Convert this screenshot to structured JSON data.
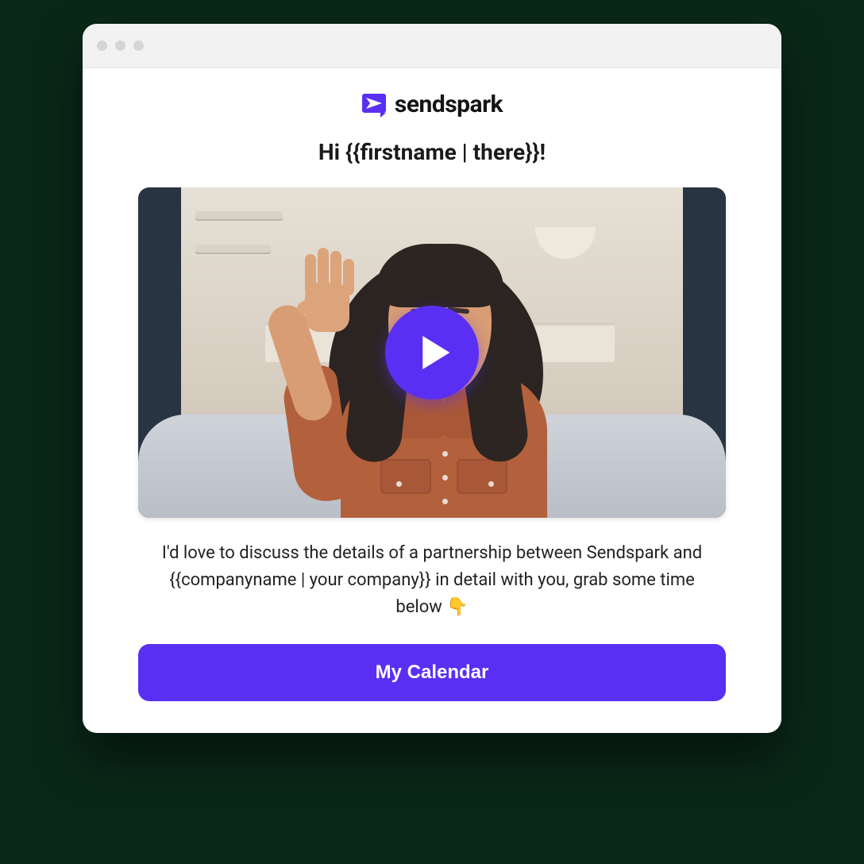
{
  "logo": {
    "text": "sendspark"
  },
  "greeting": "Hi {{firstname | there}}!",
  "body_text": "I'd love to discuss the details of a partnership between Sendspark and {{companyname | your company}} in detail with you, grab some time below 👇",
  "cta_label": "My Calendar",
  "colors": {
    "accent": "#5b2ff3"
  }
}
